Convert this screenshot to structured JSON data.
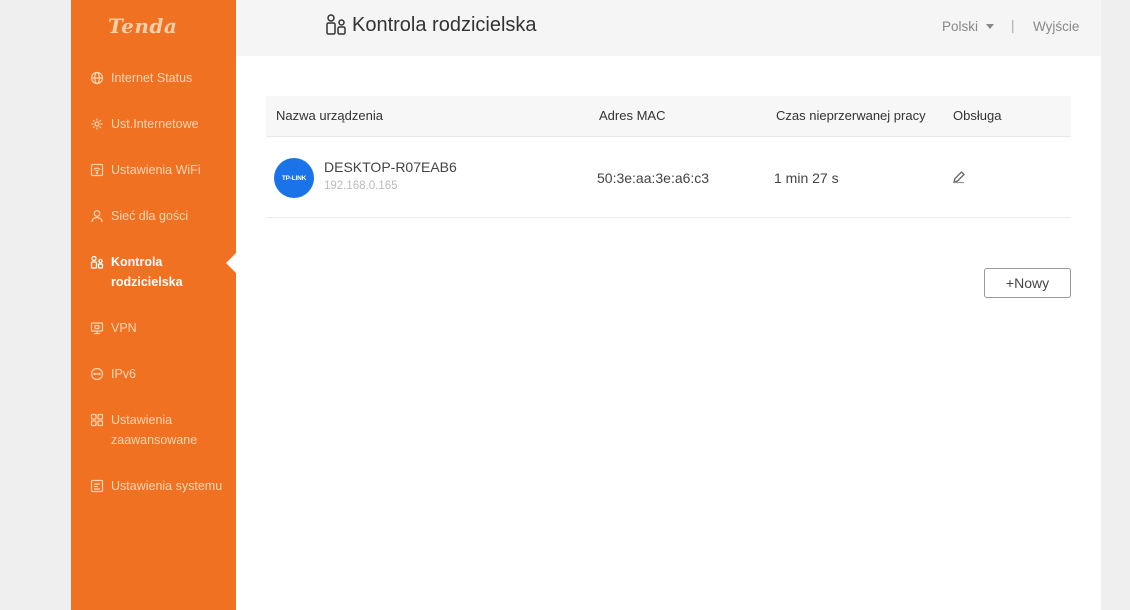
{
  "brand": {
    "logo_text": "Tenda"
  },
  "sidebar": {
    "items": [
      {
        "label": "Internet Status",
        "icon": "globe-icon"
      },
      {
        "label": "Ust.Internetowe",
        "icon": "gear-icon"
      },
      {
        "label": "Ustawienia WiFi",
        "icon": "wifi-settings-icon"
      },
      {
        "label": "Sieć dla gości",
        "icon": "guest-user-icon"
      },
      {
        "label": "Kontrola rodzicielska",
        "icon": "parental-control-icon",
        "active": true
      },
      {
        "label": "VPN",
        "icon": "vpn-icon"
      },
      {
        "label": "IPv6",
        "icon": "ipv6-icon"
      },
      {
        "label": "Ustawienia zaawansowane",
        "icon": "advanced-grid-icon"
      },
      {
        "label": "Ustawienia systemu",
        "icon": "system-settings-icon"
      }
    ]
  },
  "header": {
    "title": "Kontrola rodzicielska",
    "title_icon": "parental-control-icon",
    "language": "Polski",
    "separator": "|",
    "logout": "Wyjście"
  },
  "table": {
    "columns": {
      "device_name": "Nazwa urządzenia",
      "mac": "Adres MAC",
      "uptime": "Czas nieprzerwanej pracy",
      "action": "Obsługa"
    },
    "rows": [
      {
        "avatar_label": "TP-LINK",
        "device_name": "DESKTOP-R07EAB6",
        "ip": "192.168.0.165",
        "mac": "50:3e:aa:3e:a6:c3",
        "uptime": "1 min 27 s",
        "action_icon": "edit-pencil-icon"
      }
    ]
  },
  "new_button": {
    "label": "+Nowy"
  },
  "colors": {
    "sidebar": "#ef7121",
    "avatar": "#1a73e8"
  }
}
